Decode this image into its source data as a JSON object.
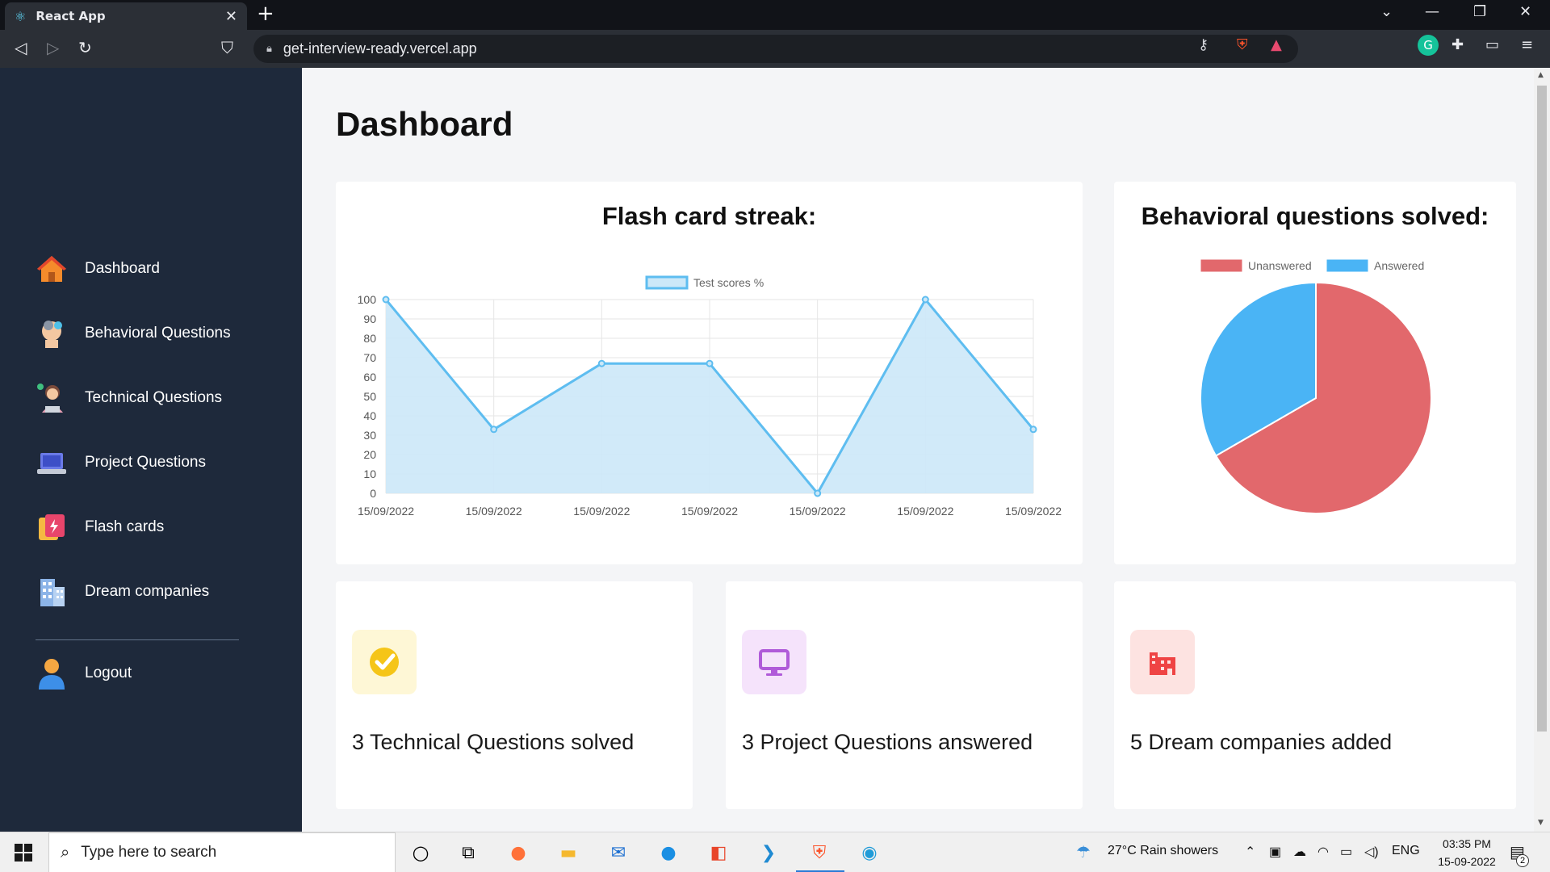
{
  "browser": {
    "tab_title": "React App",
    "url": "get-interview-ready.vercel.app"
  },
  "sidebar": {
    "items": [
      {
        "label": "Dashboard",
        "icon": "home-icon"
      },
      {
        "label": "Behavioral Questions",
        "icon": "thinking-head-icon"
      },
      {
        "label": "Technical Questions",
        "icon": "developer-icon"
      },
      {
        "label": "Project Questions",
        "icon": "laptop-icon"
      },
      {
        "label": "Flash cards",
        "icon": "flash-card-icon"
      },
      {
        "label": "Dream companies",
        "icon": "office-building-icon"
      }
    ],
    "logout_label": "Logout"
  },
  "main": {
    "title": "Dashboard",
    "streak_title": "Flash card streak:",
    "behavioral_title": "Behavioral questions solved:",
    "stats": [
      {
        "text": "3 Technical Questions solved",
        "icon": "check-badge-icon",
        "color": "#f5c518"
      },
      {
        "text": "3 Project Questions answered",
        "icon": "monitor-icon",
        "color": "#b05bd9"
      },
      {
        "text": "5 Dream companies added",
        "icon": "building-icon",
        "color": "#ef4444"
      }
    ]
  },
  "chart_data": [
    {
      "type": "area",
      "title": "Flash card streak:",
      "categories": [
        "15/09/2022",
        "15/09/2022",
        "15/09/2022",
        "15/09/2022",
        "15/09/2022",
        "15/09/2022",
        "15/09/2022"
      ],
      "series": [
        {
          "name": "Test scores %",
          "values": [
            100,
            33,
            67,
            67,
            0,
            100,
            33
          ]
        }
      ],
      "ylim": [
        0,
        100
      ],
      "yticks": [
        0,
        10,
        20,
        30,
        40,
        50,
        60,
        70,
        80,
        90,
        100
      ],
      "grid": true,
      "legend": "top",
      "colors": {
        "line": "#5ebdf0",
        "fill": "#cce8f8"
      }
    },
    {
      "type": "pie",
      "title": "Behavioral questions solved:",
      "categories": [
        "Unanswered",
        "Answered"
      ],
      "values": [
        2,
        1
      ],
      "colors": [
        "#e2686c",
        "#4ab4f5"
      ],
      "legend": "top"
    }
  ],
  "taskbar": {
    "search_placeholder": "Type here to search",
    "weather": "27°C  Rain showers",
    "language": "ENG",
    "time": "03:35 PM",
    "date": "15-09-2022",
    "notification_count": "2"
  }
}
